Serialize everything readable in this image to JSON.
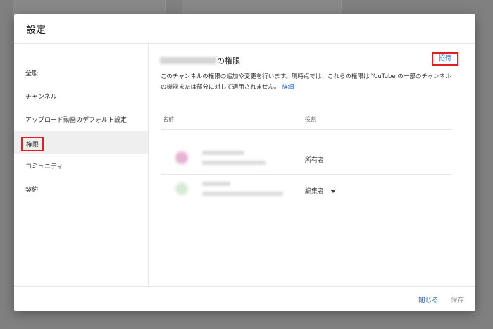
{
  "dialog": {
    "title": "設定"
  },
  "sidebar": {
    "items": [
      {
        "label": "全般"
      },
      {
        "label": "チャンネル"
      },
      {
        "label": "アップロード動画のデフォルト設定"
      },
      {
        "label": "権限",
        "active": true
      },
      {
        "label": "コミュニティ"
      },
      {
        "label": "契約"
      }
    ]
  },
  "permissions": {
    "title_suffix": "の権限",
    "invite_label": "招待",
    "description": "このチャンネルの権限の追加や変更を行います。現時点では、これらの権限は YouTube の一部のチャンネルの機能または部分に対して適用されません。",
    "details_link": "詳細",
    "columns": {
      "name": "名前",
      "role": "役割"
    },
    "members": [
      {
        "role": "所有者"
      },
      {
        "role": "編集者"
      }
    ]
  },
  "footer": {
    "close_label": "閉じる",
    "save_label": "保存"
  },
  "colors": {
    "accent": "#1a5fd0",
    "highlight": "#e02020",
    "overlay": "#7b7b7b"
  }
}
